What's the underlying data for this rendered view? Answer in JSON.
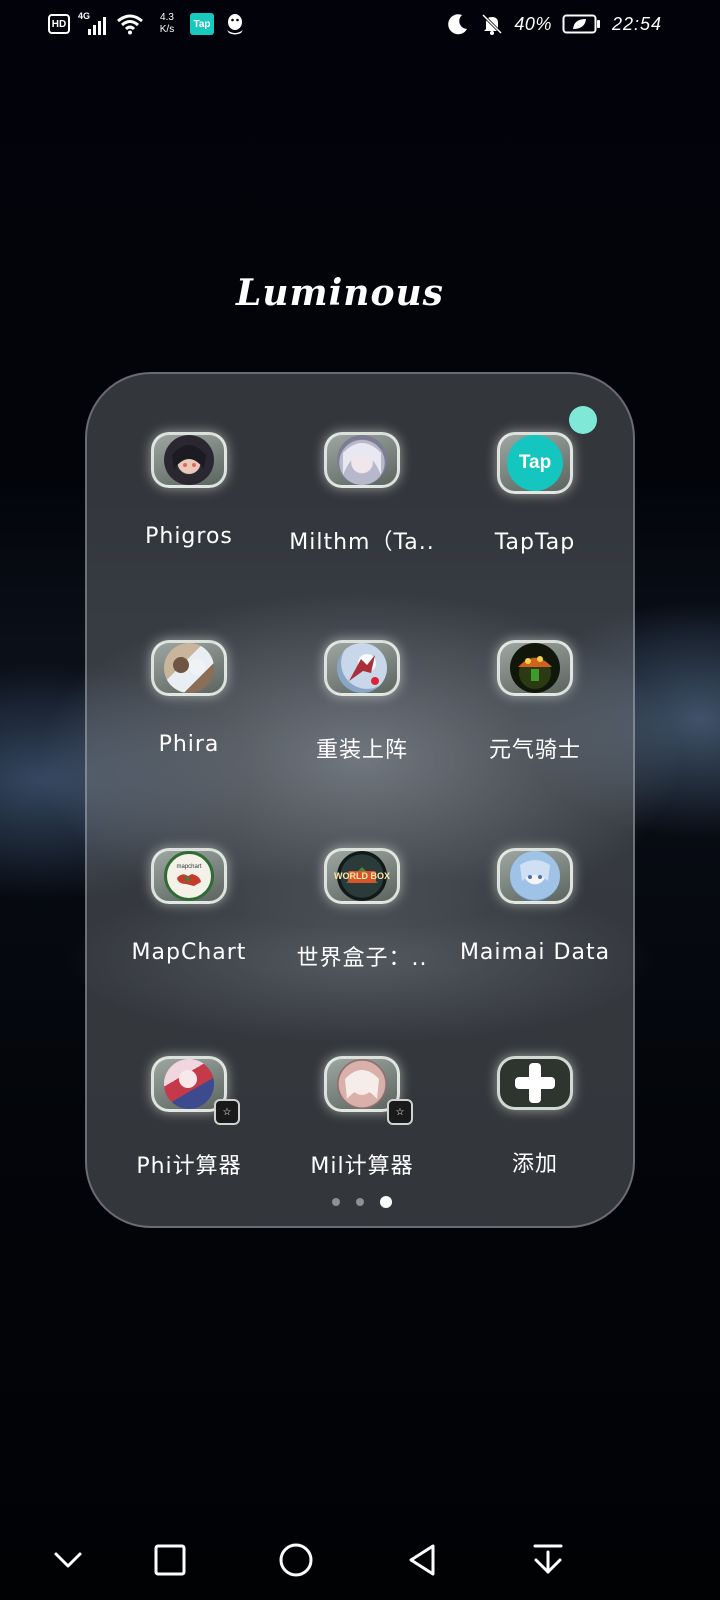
{
  "status_bar": {
    "hd": "HD",
    "network": "4G",
    "speed_value": "4.3",
    "speed_unit": "K/s",
    "tap_label": "Tap",
    "battery": "40%",
    "time": "22:54"
  },
  "folder": {
    "title": "Luminous",
    "accent_dot_color": "#7fe8d6",
    "apps": [
      {
        "label": "Phigros",
        "icon": "phigros-app-icon"
      },
      {
        "label": "Milthm（Ta..",
        "icon": "milthm-app-icon"
      },
      {
        "label": "TapTap",
        "icon": "taptap-app-icon",
        "icon_text": "Tap"
      },
      {
        "label": "Phira",
        "icon": "phira-app-icon"
      },
      {
        "label": "重装上阵",
        "icon": "mech-game-app-icon"
      },
      {
        "label": "元气骑士",
        "icon": "soul-knight-app-icon"
      },
      {
        "label": "MapChart",
        "icon": "mapchart-app-icon",
        "icon_text": "mapchart"
      },
      {
        "label": "世界盒子：..",
        "icon": "worldbox-app-icon",
        "icon_text": "WORLD BOX"
      },
      {
        "label": "Maimai Data",
        "icon": "maimai-app-icon"
      },
      {
        "label": "Phi计算器",
        "icon": "phi-calculator-app-icon"
      },
      {
        "label": "Mil计算器",
        "icon": "mil-calculator-app-icon"
      },
      {
        "label": "添加",
        "icon": "add-icon"
      }
    ],
    "pages": 3,
    "current_page": 3
  }
}
